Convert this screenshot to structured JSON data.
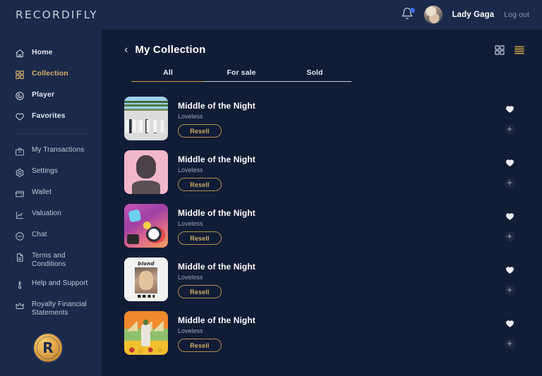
{
  "brand": {
    "logo_text": "RECORDIFLY",
    "coin_letter": "R",
    "accent_gold": "#d0ab66",
    "sidebar_bg": "#1b294a",
    "main_bg": "#111c36",
    "notification_dot": "#3f6fe0"
  },
  "topbar": {
    "bell_icon": "bell-icon",
    "has_notification": true,
    "avatar_icon": "user-avatar",
    "username": "Lady Gaga",
    "logout_label": "Log out"
  },
  "sidebar": {
    "primary_items": [
      {
        "label": "Home",
        "icon": "home-icon",
        "active": false
      },
      {
        "label": "Collection",
        "icon": "grid-icon",
        "active": true
      },
      {
        "label": "Player",
        "icon": "disc-icon",
        "active": false
      },
      {
        "label": "Favorites",
        "icon": "heart-icon",
        "active": false
      }
    ],
    "secondary_items": [
      {
        "label": "My Transactions",
        "icon": "briefcase-icon"
      },
      {
        "label": "Settings",
        "icon": "gear-icon"
      },
      {
        "label": "Wallet",
        "icon": "wallet-icon"
      },
      {
        "label": "Valuation",
        "icon": "chart-line-icon"
      },
      {
        "label": "Chat",
        "icon": "chat-bubble-icon"
      },
      {
        "label": "Terms and Conditions",
        "icon": "document-icon"
      },
      {
        "label": "Help and Support",
        "icon": "support-icon"
      },
      {
        "label": "Royalty Financial Statements",
        "icon": "crown-icon"
      }
    ]
  },
  "main": {
    "back_icon": "chevron-left-icon",
    "title": "My Collection",
    "view_toggles": [
      {
        "name": "grid-view-toggle",
        "icon": "grid-icon",
        "active": false
      },
      {
        "name": "list-view-toggle",
        "icon": "list-icon",
        "active": true
      }
    ],
    "tabs": [
      {
        "label": "All",
        "active": true
      },
      {
        "label": "For sale",
        "active": false
      },
      {
        "label": "Sold",
        "active": false
      }
    ],
    "tracks": [
      {
        "title": "Middle of the Night",
        "artist": "Loveless",
        "action_label": "Resell",
        "art": "abbey",
        "favorited": true
      },
      {
        "title": "Middle of the Night",
        "artist": "Loveless",
        "action_label": "Resell",
        "art": "pink",
        "favorited": true
      },
      {
        "title": "Middle of the Night",
        "artist": "Loveless",
        "action_label": "Resell",
        "art": "purple",
        "favorited": true
      },
      {
        "title": "Middle of the Night",
        "artist": "Loveless",
        "action_label": "Resell",
        "art": "blond",
        "favorited": true
      },
      {
        "title": "Middle of the Night",
        "artist": "Loveless",
        "action_label": "Resell",
        "art": "flower",
        "favorited": true
      }
    ]
  }
}
